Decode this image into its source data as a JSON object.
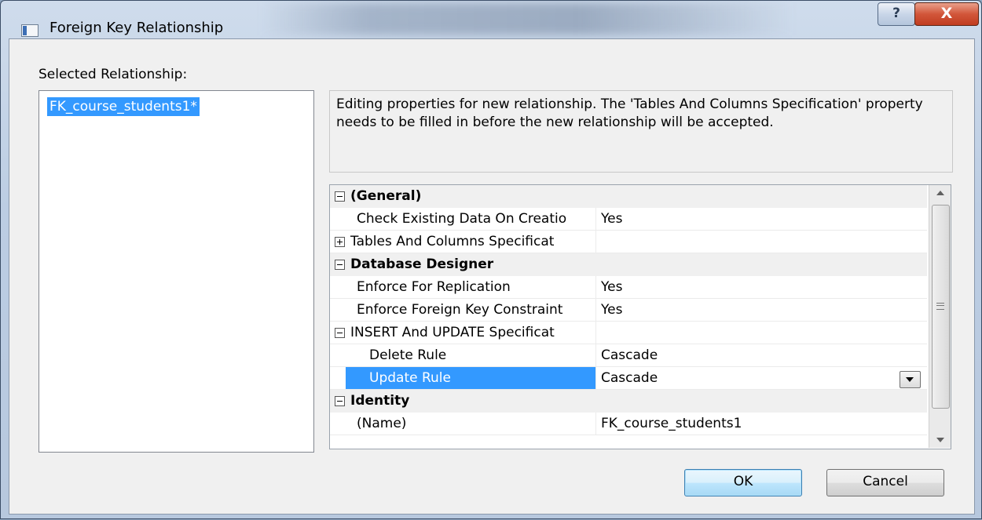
{
  "window": {
    "title": "Foreign Key Relationship",
    "help_label": "?",
    "close_label": "X"
  },
  "selected_relationship": {
    "label": "Selected Relationship:",
    "items": [
      "FK_course_students1*"
    ]
  },
  "description": "Editing properties for new relationship.  The 'Tables And Columns Specification' property needs to be filled in before the new relationship will be accepted.",
  "properties": [
    {
      "type": "category",
      "name": "(General)",
      "expanded": true
    },
    {
      "type": "property",
      "name": "Check Existing Data On Creatio",
      "value": "Yes"
    },
    {
      "type": "property",
      "name": "Tables And Columns Specificat",
      "value": "",
      "expandable": true,
      "expanded": false
    },
    {
      "type": "category",
      "name": "Database Designer",
      "expanded": true
    },
    {
      "type": "property",
      "name": "Enforce For Replication",
      "value": "Yes"
    },
    {
      "type": "property",
      "name": "Enforce Foreign Key Constraint",
      "value": "Yes"
    },
    {
      "type": "property",
      "name": "INSERT And UPDATE Specificat",
      "value": "",
      "expandable": true,
      "expanded": true
    },
    {
      "type": "property",
      "name": "Delete Rule",
      "value": "Cascade",
      "indent": 1
    },
    {
      "type": "property",
      "name": "Update Rule",
      "value": "Cascade",
      "indent": 1,
      "selected": true,
      "dropdown": true
    },
    {
      "type": "category",
      "name": "Identity",
      "expanded": true
    },
    {
      "type": "property",
      "name": "(Name)",
      "value": "FK_course_students1"
    }
  ],
  "buttons": {
    "ok": "OK",
    "cancel": "Cancel"
  },
  "colors": {
    "selection": "#3399ff",
    "close_button": "#c8462a"
  }
}
